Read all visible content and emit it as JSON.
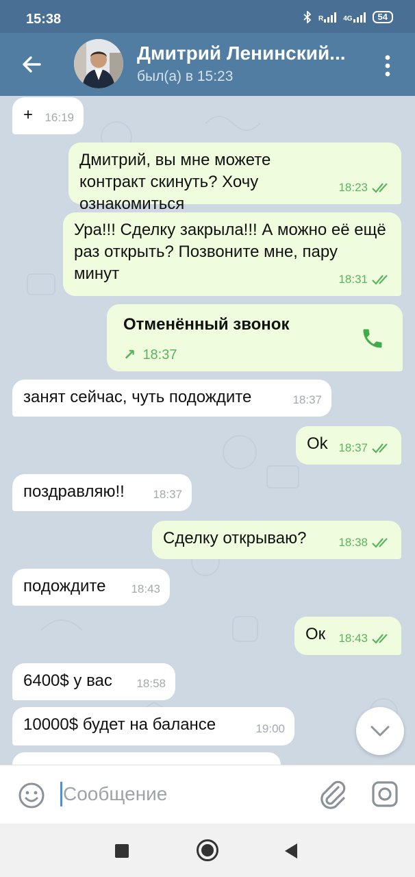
{
  "status_bar": {
    "time": "15:38",
    "net_1": "R",
    "net_2": "4G",
    "battery": "54"
  },
  "header": {
    "name": "Дмитрий Ленинский...",
    "status": "был(а) в 15:23"
  },
  "messages": [
    {
      "dir": "in",
      "text": "+",
      "time": "16:19"
    },
    {
      "dir": "out",
      "text": "Дмитрий, вы мне можете контракт скинуть? Хочу ознакомиться",
      "time": "18:23",
      "read": true
    },
    {
      "dir": "out",
      "text": "Ура!!!  Сделку закрыла!!! А можно её ещё раз открыть? Позвоните мне, пару минут",
      "time": "18:31",
      "read": true
    },
    {
      "dir": "out",
      "type": "call",
      "title": "Отменённый звонок",
      "arrow": "↗",
      "time": "18:37"
    },
    {
      "dir": "in",
      "text": "занят сейчас, чуть подождите",
      "time": "18:37"
    },
    {
      "dir": "out",
      "text": "Ok",
      "time": "18:37",
      "read": true
    },
    {
      "dir": "in",
      "text": "поздравляю!!",
      "time": "18:37"
    },
    {
      "dir": "out",
      "text": "Сделку открываю?",
      "time": "18:38",
      "read": true
    },
    {
      "dir": "in",
      "text": "подождите",
      "time": "18:43"
    },
    {
      "dir": "out",
      "text": "Ок",
      "time": "18:43",
      "read": true
    },
    {
      "dir": "in",
      "text": "6400$ у вас",
      "time": "18:58"
    },
    {
      "dir": "in",
      "text": "10000$  будет на балансе",
      "time": "19:00"
    }
  ],
  "input": {
    "placeholder": "Сообщение"
  },
  "colors": {
    "header": "#517da2",
    "outgoing_bubble": "#effdde",
    "incoming_bubble": "#ffffff",
    "read_ticks": "#5ab35f",
    "chat_bg": "#cdd8e2"
  }
}
